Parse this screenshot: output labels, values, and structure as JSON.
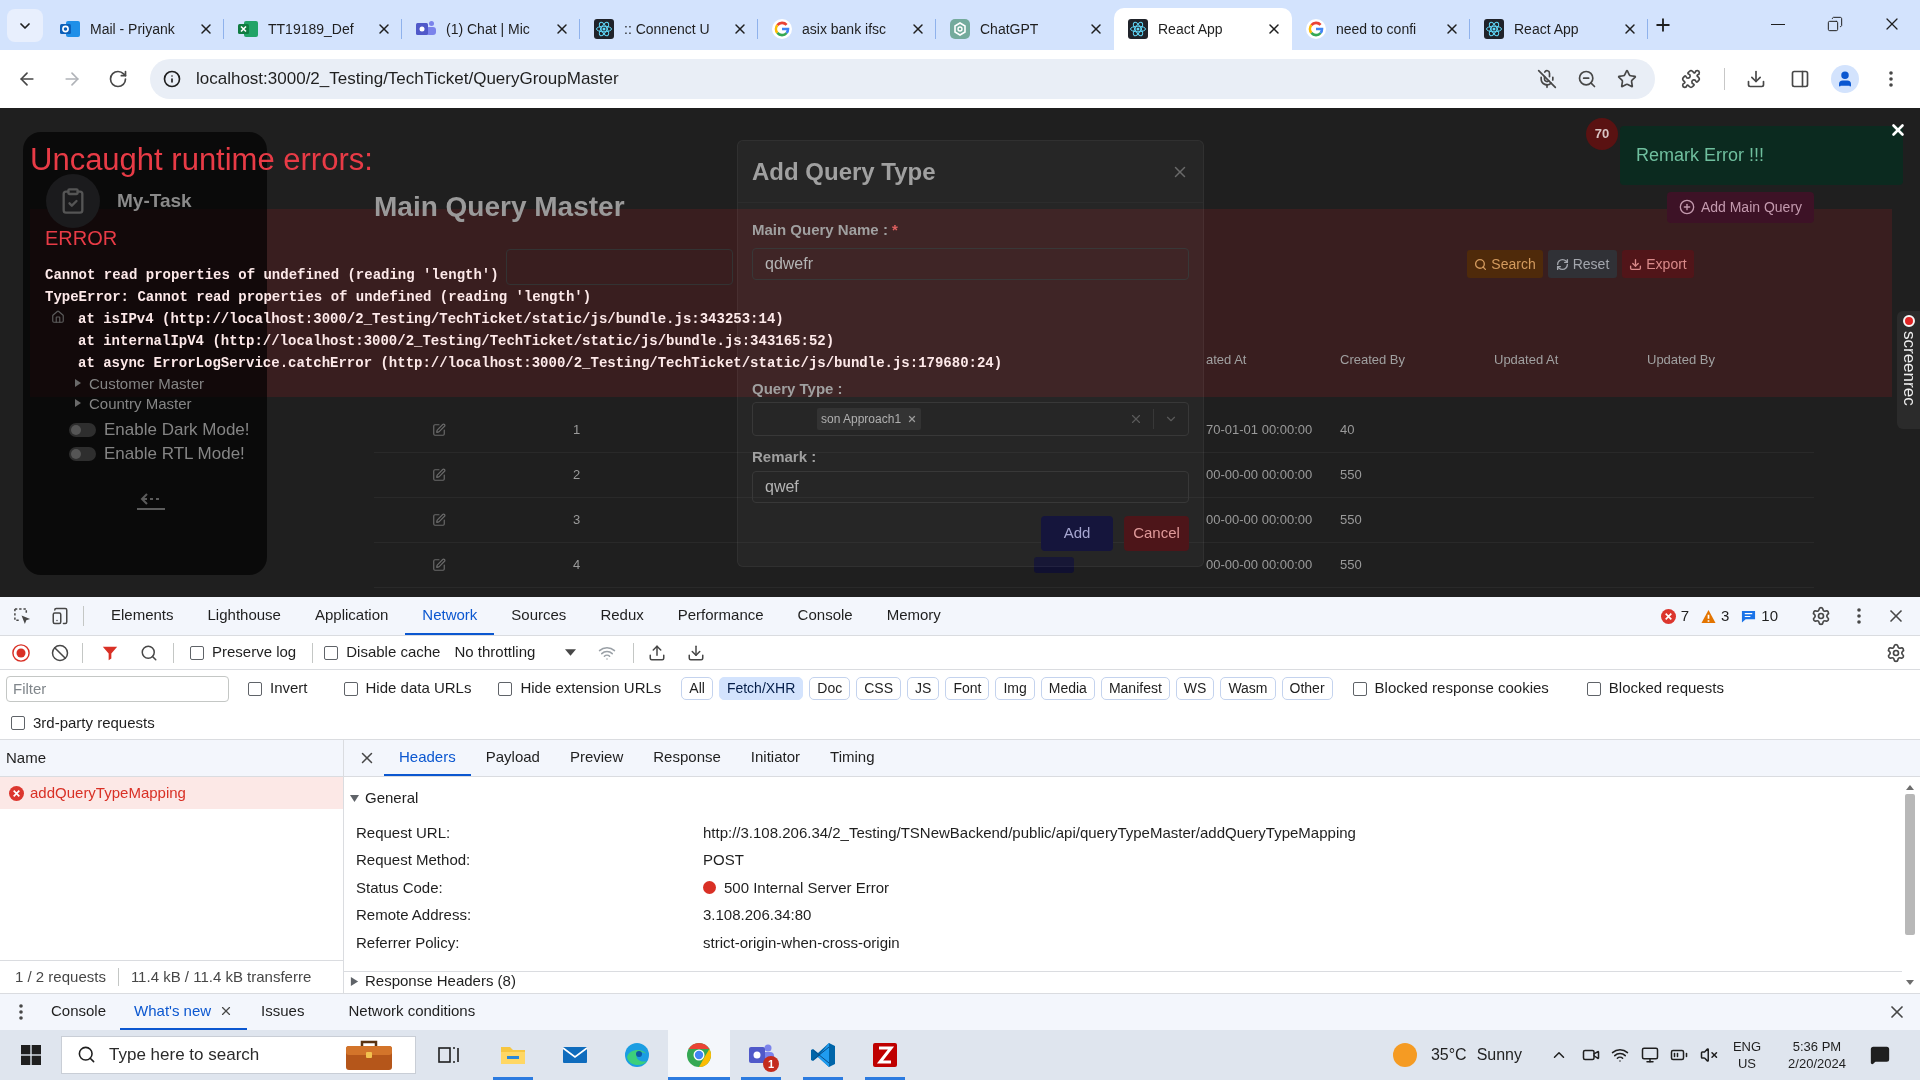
{
  "browser": {
    "tabs": [
      {
        "title": "Mail - Priyank",
        "kind": "outlook",
        "selected": false
      },
      {
        "title": "TT19189_Def",
        "kind": "excel",
        "selected": false
      },
      {
        "title": "(1) Chat | Mic",
        "kind": "teams",
        "selected": false
      },
      {
        "title": ":: Connenct U",
        "kind": "react",
        "selected": false
      },
      {
        "title": "asix bank ifsc",
        "kind": "google",
        "selected": false
      },
      {
        "title": "ChatGPT",
        "kind": "chatgpt",
        "selected": false
      },
      {
        "title": "React App",
        "kind": "react",
        "selected": true
      },
      {
        "title": "need to confi",
        "kind": "google",
        "selected": false
      },
      {
        "title": "React App",
        "kind": "react",
        "selected": false
      }
    ],
    "url": "localhost:3000/2_Testing/TechTicket/QueryGroupMaster"
  },
  "app": {
    "sidebar": {
      "brand": "My-Task",
      "sub_items": [
        "Customer Master",
        "Country Master"
      ],
      "toggles": [
        {
          "label": "Enable Dark Mode!",
          "on": false
        },
        {
          "label": "Enable RTL Mode!",
          "on": false
        }
      ]
    },
    "notification_count": "70",
    "title": "Main Query Master",
    "add_button": "Add Main Query",
    "actions": [
      {
        "label": "Search",
        "kind": "search"
      },
      {
        "label": "Reset",
        "kind": "reset"
      },
      {
        "label": "Export",
        "kind": "export"
      }
    ],
    "table": {
      "columns": [
        "ated At",
        "Created By",
        "Updated At",
        "Updated By"
      ],
      "rows": [
        {
          "number": "1",
          "created_at": "70-01-01 00:00:00",
          "created_by": "40",
          "tag": false
        },
        {
          "number": "2",
          "created_at": "00-00-00 00:00:00",
          "created_by": "550",
          "tag": false
        },
        {
          "number": "3",
          "created_at": "00-00-00 00:00:00",
          "created_by": "550",
          "tag": false
        },
        {
          "number": "4",
          "created_at": "00-00-00 00:00:00",
          "created_by": "550",
          "tag": true
        }
      ]
    },
    "toast": "Remark Error !!!",
    "modal": {
      "title": "Add Query Type",
      "fields": [
        {
          "kind": "text",
          "label": "Main Query Name :",
          "required_mark": "*",
          "value": "qdwefr"
        },
        {
          "kind": "select",
          "label": "Query Type :",
          "chips": [
            "son Approach1"
          ]
        },
        {
          "kind": "text",
          "label": "Remark :",
          "value": "qwef"
        }
      ],
      "buttons": [
        {
          "label": "Add",
          "kind": "primary"
        },
        {
          "label": "Cancel",
          "kind": "danger"
        }
      ]
    },
    "recorder_label": "screenrec"
  },
  "error_overlay": {
    "title": "Uncaught runtime errors:",
    "label": "ERROR",
    "lines": [
      {
        "kind": "message",
        "text": "Cannot read properties of undefined (reading 'length')"
      },
      {
        "kind": "message",
        "text": "TypeError: Cannot read properties of undefined (reading 'length')"
      },
      {
        "kind": "frame",
        "text": "at isIPv4 (http://localhost:3000/2_Testing/TechTicket/static/js/bundle.js:343253:14)"
      },
      {
        "kind": "frame",
        "text": "at internalIpV4 (http://localhost:3000/2_Testing/TechTicket/static/js/bundle.js:343165:52)"
      },
      {
        "kind": "frame",
        "text": "at async ErrorLogService.catchError (http://localhost:3000/2_Testing/TechTicket/static/js/bundle.js:179680:24)"
      }
    ]
  },
  "devtools": {
    "tabs": [
      {
        "label": "Elements",
        "selected": false
      },
      {
        "label": "Lighthouse",
        "selected": false
      },
      {
        "label": "Application",
        "selected": false
      },
      {
        "label": "Network",
        "selected": true
      },
      {
        "label": "Sources",
        "selected": false
      },
      {
        "label": "Redux",
        "selected": false
      },
      {
        "label": "Performance",
        "selected": false
      },
      {
        "label": "Console",
        "selected": false
      },
      {
        "label": "Memory",
        "selected": false
      }
    ],
    "issue_counts": [
      {
        "kind": "error",
        "count": "7"
      },
      {
        "kind": "warning",
        "count": "3"
      },
      {
        "kind": "info",
        "count": "10"
      }
    ],
    "recording": true,
    "toolbar_checks": [
      {
        "label": "Preserve log",
        "checked": false
      },
      {
        "label": "Disable cache",
        "checked": false
      }
    ],
    "throttling": "No throttling",
    "filter": {
      "placeholder": "Filter"
    },
    "filter_checks": [
      {
        "label": "Invert",
        "checked": false
      },
      {
        "label": "Hide data URLs",
        "checked": false
      },
      {
        "label": "Hide extension URLs",
        "checked": false
      }
    ],
    "type_filters": [
      {
        "label": "All",
        "selected": false
      },
      {
        "label": "Fetch/XHR",
        "selected": true
      },
      {
        "label": "Doc",
        "selected": false
      },
      {
        "label": "CSS",
        "selected": false
      },
      {
        "label": "JS",
        "selected": false
      },
      {
        "label": "Font",
        "selected": false
      },
      {
        "label": "Img",
        "selected": false
      },
      {
        "label": "Media",
        "selected": false
      },
      {
        "label": "Manifest",
        "selected": false
      },
      {
        "label": "WS",
        "selected": false
      },
      {
        "label": "Wasm",
        "selected": false
      },
      {
        "label": "Other",
        "selected": false
      }
    ],
    "blocked_checks": [
      {
        "label": "Blocked response cookies",
        "checked": false
      },
      {
        "label": "Blocked requests",
        "checked": false
      }
    ],
    "third_party": {
      "label": "3rd-party requests",
      "checked": false
    },
    "requests": {
      "column": "Name",
      "rows": [
        {
          "name": "addQueryTypeMapping",
          "selected": true,
          "failed": true
        }
      ],
      "summary": [
        "1 / 2 requests",
        "11.4 kB / 11.4 kB transferre"
      ]
    },
    "detail_tabs": [
      {
        "label": "Headers",
        "selected": true
      },
      {
        "label": "Payload",
        "selected": false
      },
      {
        "label": "Preview",
        "selected": false
      },
      {
        "label": "Response",
        "selected": false
      },
      {
        "label": "Initiator",
        "selected": false
      },
      {
        "label": "Timing",
        "selected": false
      }
    ],
    "sections": [
      {
        "title": "General",
        "expanded": true,
        "rows": [
          {
            "kind": "text",
            "label": "Request URL:",
            "value": "http://3.108.206.34/2_Testing/TSNewBackend/public/api/queryTypeMaster/addQueryTypeMapping"
          },
          {
            "kind": "text",
            "label": "Request Method:",
            "value": "POST"
          },
          {
            "kind": "status",
            "label": "Status Code:",
            "value": "500 Internal Server Error"
          },
          {
            "kind": "text",
            "label": "Remote Address:",
            "value": "3.108.206.34:80"
          },
          {
            "kind": "text",
            "label": "Referrer Policy:",
            "value": "strict-origin-when-cross-origin"
          }
        ]
      },
      {
        "title": "Response Headers (8)",
        "expanded": false
      }
    ],
    "drawer_tabs": [
      {
        "label": "Console",
        "selected": false,
        "closable": false
      },
      {
        "label": "What's new",
        "selected": true,
        "closable": true
      },
      {
        "label": "Issues",
        "selected": false,
        "closable": false
      },
      {
        "label": "Network conditions",
        "selected": false,
        "closable": false
      }
    ]
  },
  "taskbar": {
    "search_placeholder": "Type here to search",
    "apps": [
      {
        "kind": "explorer",
        "running": true,
        "selected": false
      },
      {
        "kind": "mail",
        "running": false,
        "selected": false
      },
      {
        "kind": "edge",
        "running": false,
        "selected": false
      },
      {
        "kind": "chrome",
        "running": true,
        "selected": true
      },
      {
        "kind": "teams",
        "running": true,
        "selected": false,
        "badge": "1"
      },
      {
        "kind": "vscode",
        "running": true,
        "selected": false
      },
      {
        "kind": "filezilla",
        "running": true,
        "selected": false
      }
    ],
    "weather": {
      "temperature": "35°C",
      "condition": "Sunny"
    },
    "language": {
      "code": "ENG",
      "region": "US"
    },
    "clock": {
      "time": "5:36 PM",
      "date": "2/20/2024"
    }
  }
}
